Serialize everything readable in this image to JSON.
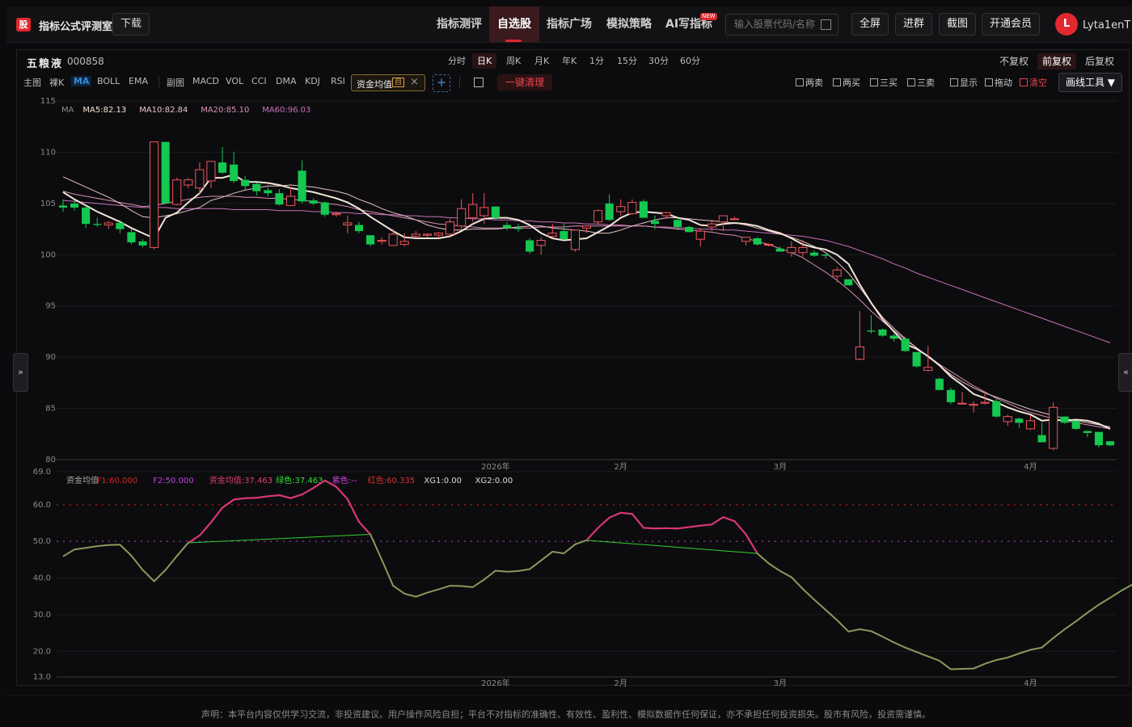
{
  "app": {
    "logo_char": "股",
    "title": "指标公式评测室",
    "download": "下载"
  },
  "nav": [
    {
      "label": "指标测评"
    },
    {
      "label": "自选股"
    },
    {
      "label": "指标广场"
    },
    {
      "label": "模拟策略"
    },
    {
      "label": "AI写指标",
      "badge": "NEW"
    }
  ],
  "search": {
    "placeholder": "输入股票代码/名称"
  },
  "toolbar": {
    "fullscreen": "全屏",
    "join": "进群",
    "screenshot": "截图",
    "vip": "开通会员"
  },
  "user": {
    "avatar": "L",
    "name": "Lyta1enT"
  },
  "stock": {
    "name": "五粮液",
    "code": "000858"
  },
  "periods": [
    "分时",
    "日K",
    "周K",
    "月K",
    "年K",
    "1分",
    "15分",
    "30分",
    "60分"
  ],
  "active_period": "日K",
  "adjust": [
    "不复权",
    "前复权",
    "后复权"
  ],
  "active_adjust": "前复权",
  "indicators_main": [
    "主图",
    "裸K",
    "MA",
    "BOLL",
    "EMA"
  ],
  "indicators_sub": [
    "副图",
    "MACD",
    "VOL",
    "CCI",
    "DMA",
    "KDJ",
    "RSI"
  ],
  "custom_indicator": {
    "label": "资金均值",
    "tag": "自"
  },
  "clear_button": "一键清理",
  "draw_options": [
    "两卖",
    "两买",
    "三买",
    "三卖",
    "显示",
    "拖动",
    "清空"
  ],
  "draw_tool": "画线工具",
  "colors": {
    "up": "#f0565c",
    "down": "#14c850",
    "ma5": "#f2e4d6",
    "ma10": "#e8c0c8",
    "ma20": "#d890b0",
    "ma60": "#c870b8",
    "accent": "#e0282e"
  },
  "main_legend": [
    {
      "label": "MA",
      "color": "#888888"
    },
    {
      "label": "MA5:82.13",
      "color": "#f2e4d6"
    },
    {
      "label": "MA10:82.84",
      "color": "#e8c0c8"
    },
    {
      "label": "MA20:85.10",
      "color": "#d890b0"
    },
    {
      "label": "MA60:96.03",
      "color": "#c870b8"
    }
  ],
  "sub_legend": [
    {
      "label": "资金均值",
      "color": "#aaaaaa"
    },
    {
      "label": "F1:60.000",
      "color": "#e02020"
    },
    {
      "label": "F2:50.000",
      "color": "#c040e0"
    },
    {
      "label": "资金均值:37.463",
      "color": "#e04070"
    },
    {
      "label": "绿色:37.463",
      "color": "#30e030"
    },
    {
      "label": "紫色:--",
      "color": "#d040e0"
    },
    {
      "label": "红色:60.335",
      "color": "#e03030"
    },
    {
      "label": "XG1:0.00",
      "color": "#dddddd"
    },
    {
      "label": "XG2:0.00",
      "color": "#dddddd"
    }
  ],
  "chart_data": [
    {
      "type": "candlestick",
      "ylim": [
        80,
        115
      ],
      "y_ticks": [
        "115",
        "110",
        "105",
        "100",
        "95",
        "90",
        "85",
        "80"
      ],
      "x_ticks": [
        "2026年",
        "2月",
        "3月",
        "4月"
      ],
      "x_tick_index": [
        38,
        49,
        63,
        85
      ],
      "candles": [
        [
          104.8,
          105.4,
          104.2,
          104.6
        ],
        [
          105.0,
          105.3,
          104.3,
          104.6
        ],
        [
          104.6,
          104.8,
          102.6,
          103.0
        ],
        [
          103.0,
          103.6,
          102.7,
          102.9
        ],
        [
          102.9,
          103.3,
          102.5,
          103.1
        ],
        [
          103.1,
          103.4,
          102.1,
          102.5
        ],
        [
          102.2,
          102.5,
          101.0,
          101.2
        ],
        [
          101.3,
          101.5,
          100.7,
          100.9
        ],
        [
          100.7,
          111.0,
          100.5,
          111.0
        ],
        [
          111.0,
          111.0,
          105.0,
          105.0
        ],
        [
          104.9,
          107.5,
          104.8,
          107.3
        ],
        [
          106.8,
          107.5,
          106.5,
          107.3
        ],
        [
          106.5,
          109.0,
          105.9,
          108.3
        ],
        [
          107.2,
          109.1,
          106.5,
          109.1
        ],
        [
          109.0,
          110.5,
          107.9,
          108.0
        ],
        [
          108.8,
          110.0,
          107.0,
          107.2
        ],
        [
          107.3,
          107.7,
          106.3,
          106.7
        ],
        [
          106.9,
          107.0,
          105.8,
          106.2
        ],
        [
          106.3,
          106.6,
          105.7,
          106.0
        ],
        [
          106.0,
          106.4,
          104.8,
          104.9
        ],
        [
          104.8,
          106.6,
          104.8,
          105.7
        ],
        [
          108.2,
          109.2,
          105.0,
          105.2
        ],
        [
          105.3,
          105.5,
          104.8,
          105.0
        ],
        [
          105.1,
          105.2,
          103.7,
          103.9
        ],
        [
          103.9,
          104.2,
          103.7,
          104.0
        ],
        [
          102.9,
          103.8,
          102.1,
          103.1
        ],
        [
          102.9,
          103.2,
          102.1,
          102.3
        ],
        [
          101.9,
          101.9,
          100.8,
          101.0
        ],
        [
          101.3,
          101.7,
          101.0,
          101.4
        ],
        [
          100.9,
          102.5,
          100.9,
          102.0
        ],
        [
          101.0,
          102.1,
          100.8,
          101.3
        ],
        [
          101.8,
          102.3,
          101.6,
          102.0
        ],
        [
          101.9,
          102.1,
          101.7,
          102.0
        ],
        [
          101.9,
          102.2,
          101.6,
          102.1
        ],
        [
          102.0,
          103.5,
          101.8,
          103.2
        ],
        [
          102.8,
          105.4,
          102.5,
          104.5
        ],
        [
          103.6,
          106.0,
          103.2,
          104.9
        ],
        [
          103.8,
          106.0,
          103.0,
          104.6
        ],
        [
          104.7,
          104.7,
          103.4,
          103.6
        ],
        [
          102.9,
          103.2,
          102.4,
          102.6
        ],
        [
          102.6,
          103.0,
          102.2,
          102.5
        ],
        [
          101.4,
          101.6,
          100.1,
          100.3
        ],
        [
          100.9,
          101.7,
          100.0,
          101.4
        ],
        [
          101.8,
          103.0,
          101.7,
          102.1
        ],
        [
          102.3,
          103.0,
          101.6,
          101.5
        ],
        [
          100.5,
          102.4,
          100.3,
          102.4
        ],
        [
          102.6,
          102.7,
          102.1,
          102.8
        ],
        [
          103.2,
          104.4,
          102.9,
          104.3
        ],
        [
          105.0,
          105.9,
          103.3,
          103.4
        ],
        [
          104.2,
          105.4,
          103.8,
          104.7
        ],
        [
          104.0,
          105.4,
          103.9,
          105.1
        ],
        [
          105.2,
          105.4,
          103.6,
          103.6
        ],
        [
          103.3,
          103.8,
          102.5,
          103.0
        ],
        [
          103.8,
          104.2,
          103.5,
          104.1
        ],
        [
          103.4,
          103.6,
          102.4,
          102.7
        ],
        [
          102.7,
          102.8,
          102.2,
          102.2
        ],
        [
          101.5,
          102.6,
          100.8,
          102.3
        ],
        [
          102.7,
          103.4,
          102.3,
          103.0
        ],
        [
          103.2,
          103.7,
          102.3,
          103.8
        ],
        [
          103.5,
          103.7,
          103.4,
          103.5
        ],
        [
          101.3,
          101.6,
          100.9,
          101.7
        ],
        [
          101.6,
          101.7,
          100.9,
          101.0
        ],
        [
          101.0,
          101.1,
          100.8,
          101.0
        ],
        [
          100.6,
          100.8,
          100.3,
          100.3
        ],
        [
          100.2,
          101.3,
          99.8,
          100.7
        ],
        [
          100.2,
          101.4,
          99.8,
          100.7
        ],
        [
          100.2,
          100.4,
          99.8,
          99.9
        ],
        [
          100.0,
          100.1,
          99.6,
          99.9
        ],
        [
          97.9,
          98.8,
          97.3,
          98.5
        ],
        [
          97.6,
          97.6,
          97.0,
          97.0
        ],
        [
          89.8,
          94.5,
          89.7,
          91.0
        ],
        [
          92.6,
          94.1,
          92.3,
          92.5
        ],
        [
          92.7,
          92.8,
          92.0,
          92.1
        ],
        [
          92.1,
          92.3,
          91.5,
          91.8
        ],
        [
          91.8,
          92.0,
          90.5,
          90.6
        ],
        [
          90.5,
          90.5,
          89.0,
          89.1
        ],
        [
          88.7,
          91.1,
          88.6,
          89.0
        ],
        [
          87.9,
          88.0,
          86.8,
          86.8
        ],
        [
          86.8,
          87.0,
          85.4,
          85.6
        ],
        [
          85.5,
          86.6,
          85.4,
          85.5
        ],
        [
          85.3,
          85.7,
          84.6,
          85.4
        ],
        [
          85.5,
          86.6,
          85.4,
          85.6
        ],
        [
          85.7,
          85.9,
          84.1,
          84.2
        ],
        [
          83.7,
          84.4,
          83.3,
          84.2
        ],
        [
          84.0,
          84.1,
          83.1,
          83.6
        ],
        [
          83.0,
          84.3,
          82.9,
          83.8
        ],
        [
          82.4,
          83.6,
          81.8,
          81.7
        ],
        [
          81.1,
          85.6,
          80.9,
          85.1
        ],
        [
          84.2,
          84.2,
          83.5,
          83.6
        ],
        [
          83.8,
          83.8,
          82.9,
          83.0
        ],
        [
          82.8,
          82.8,
          82.2,
          82.6
        ],
        [
          82.7,
          82.7,
          81.2,
          81.4
        ],
        [
          81.8,
          81.8,
          81.3,
          81.4
        ]
      ],
      "ma5": [
        106.1,
        105.4,
        104.8,
        104.2,
        103.7,
        103.2,
        102.6,
        102.1,
        101.6,
        103.6,
        104.1,
        105.1,
        106.0,
        107.5,
        107.5,
        107.8,
        107.1,
        107.1,
        107.0,
        106.8,
        106.5,
        106.3,
        106.1,
        105.8,
        105.5,
        105.1,
        104.5,
        103.7,
        103.0,
        102.3,
        101.7,
        101.6,
        101.6,
        101.6,
        101.8,
        102.3,
        103.0,
        103.5,
        103.6,
        103.6,
        103.4,
        102.9,
        102.1,
        101.6,
        101.4,
        101.5,
        101.6,
        102.2,
        102.8,
        103.6,
        104.1,
        104.2,
        104.1,
        104.0,
        103.6,
        103.4,
        102.9,
        102.8,
        103.0,
        103.1,
        103.0,
        102.8,
        102.4,
        102.1,
        101.6,
        101.0,
        100.7,
        100.5,
        100.0,
        99.1,
        97.1,
        95.3,
        93.7,
        92.5,
        91.3,
        90.8,
        90.1,
        89.2,
        88.1,
        87.3,
        86.4,
        86.0,
        85.6,
        85.1,
        84.7,
        84.4,
        83.8,
        83.9,
        83.8,
        83.9,
        83.8,
        83.5,
        83.0
      ],
      "ma10": [
        107.6,
        107.1,
        106.6,
        106.1,
        105.6,
        105.0,
        104.3,
        103.7,
        103.6,
        103.8,
        104.0,
        104.3,
        104.6,
        105.3,
        105.6,
        106.0,
        106.3,
        106.5,
        106.7,
        106.7,
        106.8,
        106.7,
        106.6,
        106.4,
        106.2,
        105.9,
        105.4,
        105.0,
        104.5,
        104.1,
        103.8,
        103.4,
        102.9,
        102.6,
        102.4,
        102.4,
        102.5,
        102.5,
        102.5,
        102.6,
        102.7,
        102.8,
        102.8,
        102.6,
        102.5,
        102.4,
        102.3,
        102.1,
        102.1,
        102.4,
        102.8,
        103.1,
        103.4,
        103.6,
        103.6,
        103.5,
        103.4,
        103.3,
        103.2,
        103.1,
        102.9,
        102.6,
        102.3,
        102.0,
        101.7,
        101.3,
        100.8,
        100.2,
        99.3,
        98.2,
        96.8,
        95.3,
        93.9,
        92.8,
        91.8,
        90.9,
        90.0,
        89.2,
        88.3,
        87.6,
        87.0,
        86.5,
        86.1,
        85.7,
        85.3,
        84.9,
        84.6,
        84.3,
        84.0,
        83.8,
        83.6,
        83.4,
        83.2
      ],
      "ma20": [
        106.2,
        105.9,
        105.7,
        105.5,
        105.3,
        105.1,
        104.9,
        104.7,
        104.8,
        105.0,
        105.2,
        105.4,
        105.6,
        105.7,
        105.7,
        105.7,
        105.6,
        105.6,
        105.5,
        105.5,
        105.4,
        105.3,
        105.2,
        105.0,
        104.9,
        104.7,
        104.4,
        104.2,
        104.0,
        103.8,
        103.6,
        103.4,
        103.2,
        103.0,
        102.9,
        102.8,
        102.7,
        102.6,
        102.6,
        102.6,
        102.6,
        102.6,
        102.7,
        102.7,
        102.7,
        102.8,
        102.8,
        102.8,
        102.8,
        102.8,
        102.8,
        102.8,
        102.7,
        102.6,
        102.5,
        102.4,
        102.3,
        102.2,
        102.0,
        101.9,
        101.6,
        101.3,
        101.0,
        100.6,
        100.2,
        99.7,
        99.0,
        98.3,
        97.5,
        96.6,
        95.6,
        94.5,
        93.5,
        92.6,
        91.7,
        90.9,
        90.1,
        89.3,
        88.6,
        87.9,
        87.2,
        86.6,
        86.0,
        85.5,
        85.0,
        84.6,
        84.3,
        84.0,
        83.8,
        83.6,
        83.4,
        83.2,
        83.0
      ],
      "ma60": [
        105.3,
        105.2,
        105.1,
        105.0,
        104.9,
        104.8,
        104.7,
        104.6,
        104.6,
        104.6,
        104.5,
        104.5,
        104.5,
        104.5,
        104.5,
        104.4,
        104.4,
        104.4,
        104.4,
        104.3,
        104.3,
        104.3,
        104.2,
        104.2,
        104.1,
        104.1,
        104.0,
        104.0,
        103.9,
        103.9,
        103.8,
        103.8,
        103.7,
        103.7,
        103.6,
        103.6,
        103.5,
        103.5,
        103.4,
        103.4,
        103.3,
        103.3,
        103.2,
        103.2,
        103.1,
        103.1,
        103.0,
        103.0,
        102.9,
        102.9,
        102.8,
        102.8,
        102.7,
        102.7,
        102.6,
        102.6,
        102.5,
        102.5,
        102.4,
        102.4,
        102.3,
        102.2,
        102.1,
        102.0,
        101.9,
        101.8,
        101.6,
        101.4,
        101.1,
        100.8,
        100.4,
        100.0,
        99.6,
        99.1,
        98.7,
        98.2,
        97.8,
        97.4,
        97.0,
        96.6,
        96.2,
        95.8,
        95.4,
        95.0,
        94.6,
        94.2,
        93.8,
        93.4,
        93.0,
        92.6,
        92.2,
        91.8,
        91.4
      ]
    },
    {
      "type": "line",
      "ylim": [
        13,
        69
      ],
      "y_ticks": [
        "69.0",
        "60.0",
        "50.0",
        "40.0",
        "30.0",
        "20.0",
        "13.0"
      ],
      "x_ticks": [
        "2026年",
        "2月",
        "3月",
        "4月"
      ],
      "reference_lines": [
        {
          "name": "F1",
          "value": 60,
          "color": "#e02020"
        },
        {
          "name": "F2",
          "value": 50,
          "color": "#c040e0"
        }
      ],
      "values": [
        45.9,
        47.8,
        48.2,
        48.7,
        49.0,
        49.1,
        46.1,
        42.2,
        39.1,
        42.2,
        46.0,
        49.6,
        51.6,
        55.2,
        59.2,
        61.4,
        61.8,
        61.9,
        62.3,
        62.6,
        61.8,
        62.8,
        64.6,
        66.6,
        64.9,
        61.5,
        55.3,
        51.9,
        45.0,
        37.9,
        35.7,
        34.9,
        36.0,
        36.9,
        37.9,
        37.8,
        37.5,
        39.6,
        42.0,
        41.7,
        41.9,
        42.4,
        44.8,
        47.2,
        46.7,
        49.2,
        50.3,
        53.7,
        56.5,
        57.8,
        57.5,
        53.7,
        53.5,
        53.6,
        53.5,
        53.9,
        54.3,
        54.6,
        56.6,
        55.5,
        51.9,
        46.7,
        44.0,
        41.9,
        40.2,
        37.0,
        34.1,
        31.3,
        28.5,
        25.4,
        26.0,
        25.5,
        24.0,
        22.4,
        21.0,
        19.8,
        18.6,
        17.4,
        15.1,
        15.2,
        15.3,
        16.6,
        17.6,
        18.3,
        19.4,
        20.4,
        21.0,
        23.6,
        26.0,
        28.2,
        30.5,
        32.7,
        34.6,
        36.6,
        38.3
      ],
      "red_from": 11,
      "red_to": 27,
      "red2_from": 46,
      "red2_to": 61,
      "green_segments": [
        [
          11,
          27
        ],
        [
          46,
          61
        ]
      ]
    }
  ],
  "disclaimer": "声明：本平台内容仅供学习交流，非投资建议。用户操作风险自担；平台不对指标的准确性、有效性、盈利性、模拟数据作任何保证，亦不承担任何投资损失。股市有风险，投资需谨慎。"
}
